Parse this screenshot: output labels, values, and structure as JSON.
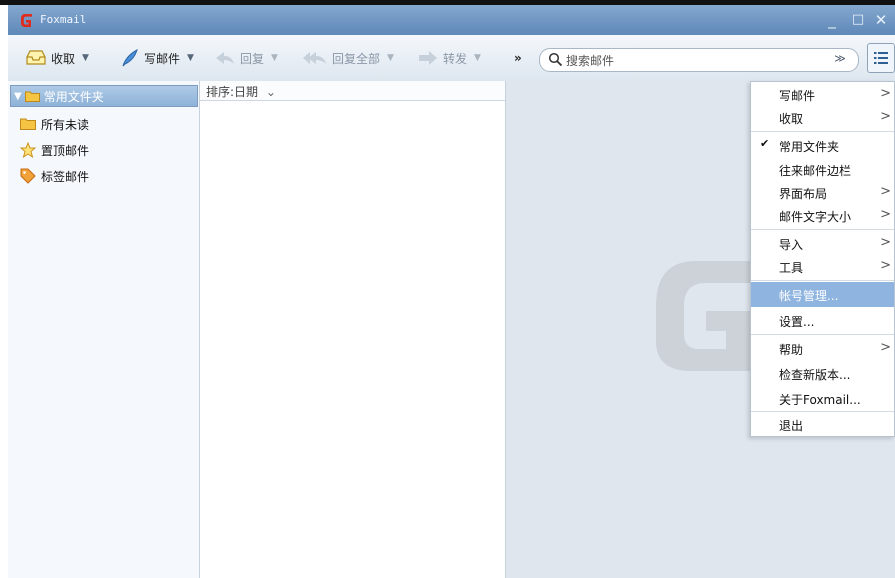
{
  "window": {
    "title": "Foxmail",
    "controls": {
      "minimize": "_",
      "maximize": "□",
      "close": "✕"
    }
  },
  "toolbar": {
    "receive_label": "收取",
    "compose_label": "写邮件",
    "reply_label": "回复",
    "reply_all_label": "回复全部",
    "forward_label": "转发",
    "more_label": "»"
  },
  "search": {
    "placeholder": "搜索邮件",
    "options_glyph": "≫"
  },
  "sidebar": {
    "group_label": "常用文件夹",
    "items": [
      {
        "label": "所有未读",
        "icon": "folder-icon"
      },
      {
        "label": "置顶邮件",
        "icon": "star-icon"
      },
      {
        "label": "标签邮件",
        "icon": "tag-icon"
      }
    ]
  },
  "maillist": {
    "sort_label": "排序:日期",
    "sort_arrow": "⌄"
  },
  "menu": {
    "items": [
      {
        "label": "写邮件",
        "submenu": true
      },
      {
        "label": "收取",
        "submenu": true
      },
      {
        "label": "常用文件夹",
        "checked": true
      },
      {
        "label": "往来邮件边栏"
      },
      {
        "label": "界面布局",
        "submenu": true
      },
      {
        "label": "邮件文字大小",
        "submenu": true
      },
      {
        "label": "导入",
        "submenu": true
      },
      {
        "label": "工具",
        "submenu": true
      },
      {
        "label": "帐号管理...",
        "highlighted": true
      },
      {
        "label": "设置..."
      },
      {
        "label": "帮助",
        "submenu": true
      },
      {
        "label": "检查新版本..."
      },
      {
        "label": "关于Foxmail..."
      },
      {
        "label": "退出"
      }
    ],
    "submenu_glyph": ">",
    "check_glyph": "✔"
  },
  "colors": {
    "title_bar": "#6f95c2",
    "highlight": "#8eb4df",
    "brand_red": "#e02c1f"
  }
}
